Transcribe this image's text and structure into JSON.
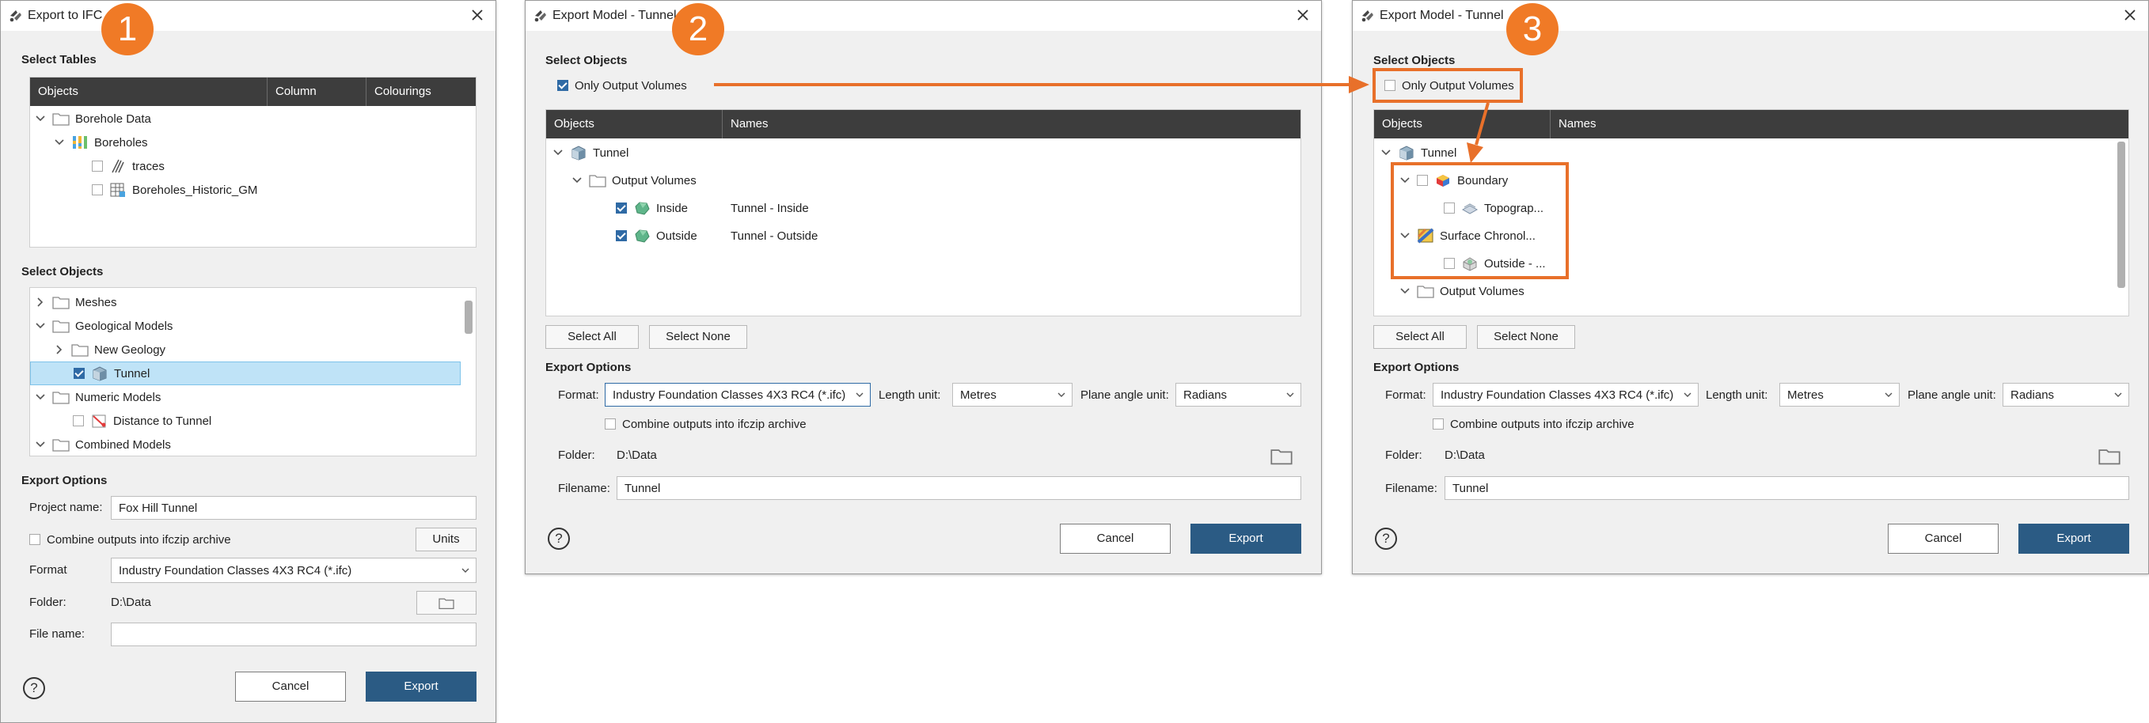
{
  "colors": {
    "accent": "#f07a26",
    "primary_button": "#2b5b84",
    "header_bg": "#3d3d3d",
    "selection": "#bfe3f7"
  },
  "badges": [
    "1",
    "2",
    "3"
  ],
  "d1": {
    "title": "Export to IFC",
    "select_tables_label": "Select Tables",
    "tables_columns": [
      "Objects",
      "Column",
      "Colourings"
    ],
    "tables_tree": [
      {
        "label": "Borehole Data",
        "icon": "folder-icon"
      },
      {
        "label": "Boreholes",
        "icon": "boreholes-icon"
      },
      {
        "label": "traces",
        "icon": "traces-icon"
      },
      {
        "label": "Boreholes_Historic_GM",
        "icon": "table-icon"
      }
    ],
    "select_objects_label": "Select Objects",
    "objects_tree": [
      {
        "label": "Meshes",
        "icon": "folder-icon"
      },
      {
        "label": "Geological Models",
        "icon": "folder-icon"
      },
      {
        "label": "New Geology",
        "icon": "folder-icon"
      },
      {
        "label": "Tunnel",
        "icon": "tunnel-icon",
        "checked": true,
        "selected": true
      },
      {
        "label": "Numeric Models",
        "icon": "folder-icon"
      },
      {
        "label": "Distance to Tunnel",
        "icon": "numeric-model-icon"
      },
      {
        "label": "Combined Models",
        "icon": "folder-icon"
      }
    ],
    "export_options_label": "Export Options",
    "project_name_label": "Project name:",
    "project_name_value": "Fox Hill Tunnel",
    "combine_label": "Combine outputs into ifczip archive",
    "units_button": "Units",
    "format_label": "Format",
    "format_value": "Industry Foundation Classes 4X3 RC4 (*.ifc)",
    "folder_label": "Folder:",
    "folder_value": "D:\\Data",
    "file_name_label": "File name:",
    "file_name_value": "",
    "help": "?",
    "cancel": "Cancel",
    "export": "Export"
  },
  "d2": {
    "title": "Export Model - Tunnel",
    "select_objects_label": "Select Objects",
    "only_output_label": "Only Output Volumes",
    "only_output_checked": true,
    "columns": [
      "Objects",
      "Names"
    ],
    "tree": [
      {
        "label": "Tunnel",
        "name": "",
        "icon": "tunnel-icon"
      },
      {
        "label": "Output Volumes",
        "name": "",
        "icon": "folder-icon"
      },
      {
        "label": "Inside",
        "name": "Tunnel - Inside",
        "icon": "volume-icon",
        "checked": true
      },
      {
        "label": "Outside",
        "name": "Tunnel - Outside",
        "icon": "volume-icon",
        "checked": true
      }
    ],
    "select_all": "Select All",
    "select_none": "Select None",
    "export_options_label": "Export Options",
    "format_label": "Format:",
    "format_value": "Industry Foundation Classes 4X3 RC4 (*.ifc)",
    "length_unit_label": "Length unit:",
    "length_unit_value": "Metres",
    "plane_angle_label": "Plane angle unit:",
    "plane_angle_value": "Radians",
    "combine_label": "Combine outputs into ifczip archive",
    "folder_label": "Folder:",
    "folder_value": "D:\\Data",
    "filename_label": "Filename:",
    "filename_value": "Tunnel",
    "help": "?",
    "cancel": "Cancel",
    "export": "Export"
  },
  "d3": {
    "title": "Export Model - Tunnel",
    "select_objects_label": "Select Objects",
    "only_output_label": "Only Output Volumes",
    "only_output_checked": false,
    "columns": [
      "Objects",
      "Names"
    ],
    "tree": [
      {
        "label": "Tunnel",
        "icon": "tunnel-icon"
      },
      {
        "label": "Boundary",
        "icon": "boundary-icon"
      },
      {
        "label": "Topograp...",
        "icon": "surface-icon"
      },
      {
        "label": "Surface Chronol...",
        "icon": "chronology-icon"
      },
      {
        "label": "Outside - ...",
        "icon": "volume-grey-icon"
      },
      {
        "label": "Output Volumes",
        "icon": "folder-icon"
      }
    ],
    "select_all": "Select All",
    "select_none": "Select None",
    "export_options_label": "Export Options",
    "format_label": "Format:",
    "format_value": "Industry Foundation Classes 4X3 RC4 (*.ifc)",
    "length_unit_label": "Length unit:",
    "length_unit_value": "Metres",
    "plane_angle_label": "Plane angle unit:",
    "plane_angle_value": "Radians",
    "combine_label": "Combine outputs into ifczip archive",
    "folder_label": "Folder:",
    "folder_value": "D:\\Data",
    "filename_label": "Filename:",
    "filename_value": "Tunnel",
    "help": "?",
    "cancel": "Cancel",
    "export": "Export"
  }
}
